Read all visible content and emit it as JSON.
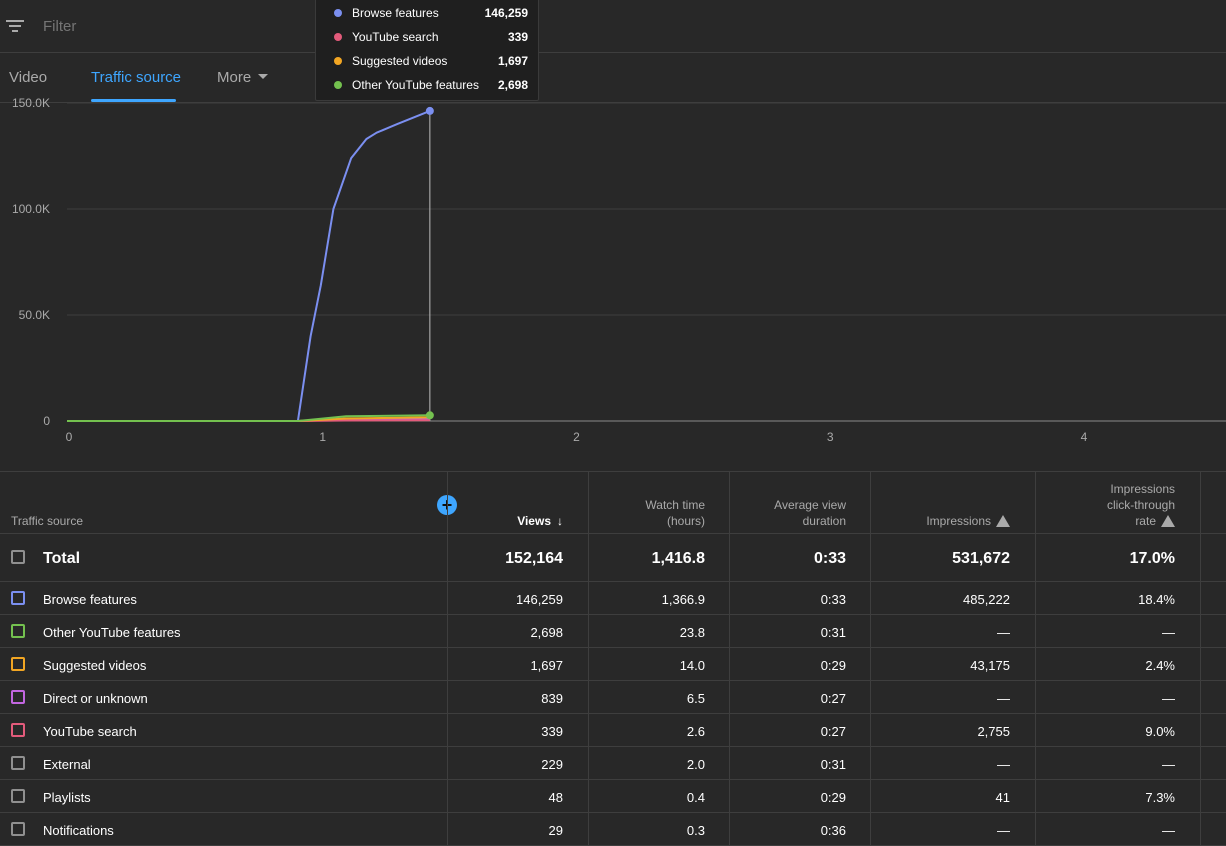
{
  "filter": {
    "placeholder": "Filter"
  },
  "tabs": [
    {
      "label": "Video"
    },
    {
      "label": "Traffic source",
      "active": true
    },
    {
      "label": "More"
    }
  ],
  "chart_data": {
    "type": "line",
    "x_ticks": [
      "0",
      "1",
      "2",
      "3",
      "4"
    ],
    "y_ticks": [
      "0",
      "50.0K",
      "100.0K",
      "150.0K"
    ],
    "xlim": [
      0,
      4.6
    ],
    "ylim": [
      0,
      150000
    ],
    "series": [
      {
        "name": "Browse features",
        "color": "#7b8ff0",
        "x": [
          0,
          0.91,
          0.96,
          1.0,
          1.05,
          1.12,
          1.18,
          1.22,
          1.3,
          1.43
        ],
        "y": [
          0,
          0,
          40000,
          64000,
          100000,
          124000,
          133000,
          136000,
          140000,
          146259
        ]
      },
      {
        "name": "YouTube search",
        "color": "#e35b7b",
        "x": [
          0,
          0.91,
          1.1,
          1.43
        ],
        "y": [
          0,
          0,
          250,
          339
        ]
      },
      {
        "name": "Suggested videos",
        "color": "#f2a623",
        "x": [
          0,
          0.91,
          1.1,
          1.43
        ],
        "y": [
          0,
          0,
          1200,
          1697
        ]
      },
      {
        "name": "Other YouTube features",
        "color": "#74c14f",
        "x": [
          0,
          0.91,
          1.1,
          1.43
        ],
        "y": [
          0,
          0,
          2200,
          2698
        ]
      },
      {
        "name": "Direct or unknown",
        "color": "#c266e0",
        "x": [
          0,
          0.91,
          1.1,
          1.43
        ],
        "y": [
          0,
          0,
          600,
          839
        ]
      }
    ],
    "hover_x": 1.43,
    "grid": true
  },
  "tooltip": {
    "items": [
      {
        "label": "Browse features",
        "value": "146,259",
        "color": "#7b8ff0"
      },
      {
        "label": "YouTube search",
        "value": "339",
        "color": "#e35b7b"
      },
      {
        "label": "Suggested videos",
        "value": "1,697",
        "color": "#f2a623"
      },
      {
        "label": "Other YouTube features",
        "value": "2,698",
        "color": "#74c14f"
      }
    ]
  },
  "table": {
    "headers": {
      "source": "Traffic source",
      "views": "Views",
      "watch_time": [
        "Watch time",
        "(hours)"
      ],
      "avg_view": [
        "Average view",
        "duration"
      ],
      "impressions": "Impressions",
      "ctr": [
        "Impressions",
        "click-through",
        "rate"
      ]
    },
    "total": {
      "label": "Total",
      "views": "152,164",
      "watch": "1,416.8",
      "avg": "0:33",
      "impressions": "531,672",
      "ctr": "17.0%"
    },
    "rows": [
      {
        "label": "Browse features",
        "color": "#7b8ff0",
        "views": "146,259",
        "watch": "1,366.9",
        "avg": "0:33",
        "impressions": "485,222",
        "ctr": "18.4%"
      },
      {
        "label": "Other YouTube features",
        "color": "#74c14f",
        "views": "2,698",
        "watch": "23.8",
        "avg": "0:31",
        "impressions": "—",
        "ctr": "—"
      },
      {
        "label": "Suggested videos",
        "color": "#f2a623",
        "views": "1,697",
        "watch": "14.0",
        "avg": "0:29",
        "impressions": "43,175",
        "ctr": "2.4%"
      },
      {
        "label": "Direct or unknown",
        "color": "#c266e0",
        "views": "839",
        "watch": "6.5",
        "avg": "0:27",
        "impressions": "—",
        "ctr": "—"
      },
      {
        "label": "YouTube search",
        "color": "#e35b7b",
        "views": "339",
        "watch": "2.6",
        "avg": "0:27",
        "impressions": "2,755",
        "ctr": "9.0%"
      },
      {
        "label": "External",
        "color": "#909090",
        "views": "229",
        "watch": "2.0",
        "avg": "0:31",
        "impressions": "—",
        "ctr": "—"
      },
      {
        "label": "Playlists",
        "color": "#909090",
        "views": "48",
        "watch": "0.4",
        "avg": "0:29",
        "impressions": "41",
        "ctr": "7.3%"
      },
      {
        "label": "Notifications",
        "color": "#909090",
        "views": "29",
        "watch": "0.3",
        "avg": "0:36",
        "impressions": "—",
        "ctr": "—"
      }
    ]
  }
}
